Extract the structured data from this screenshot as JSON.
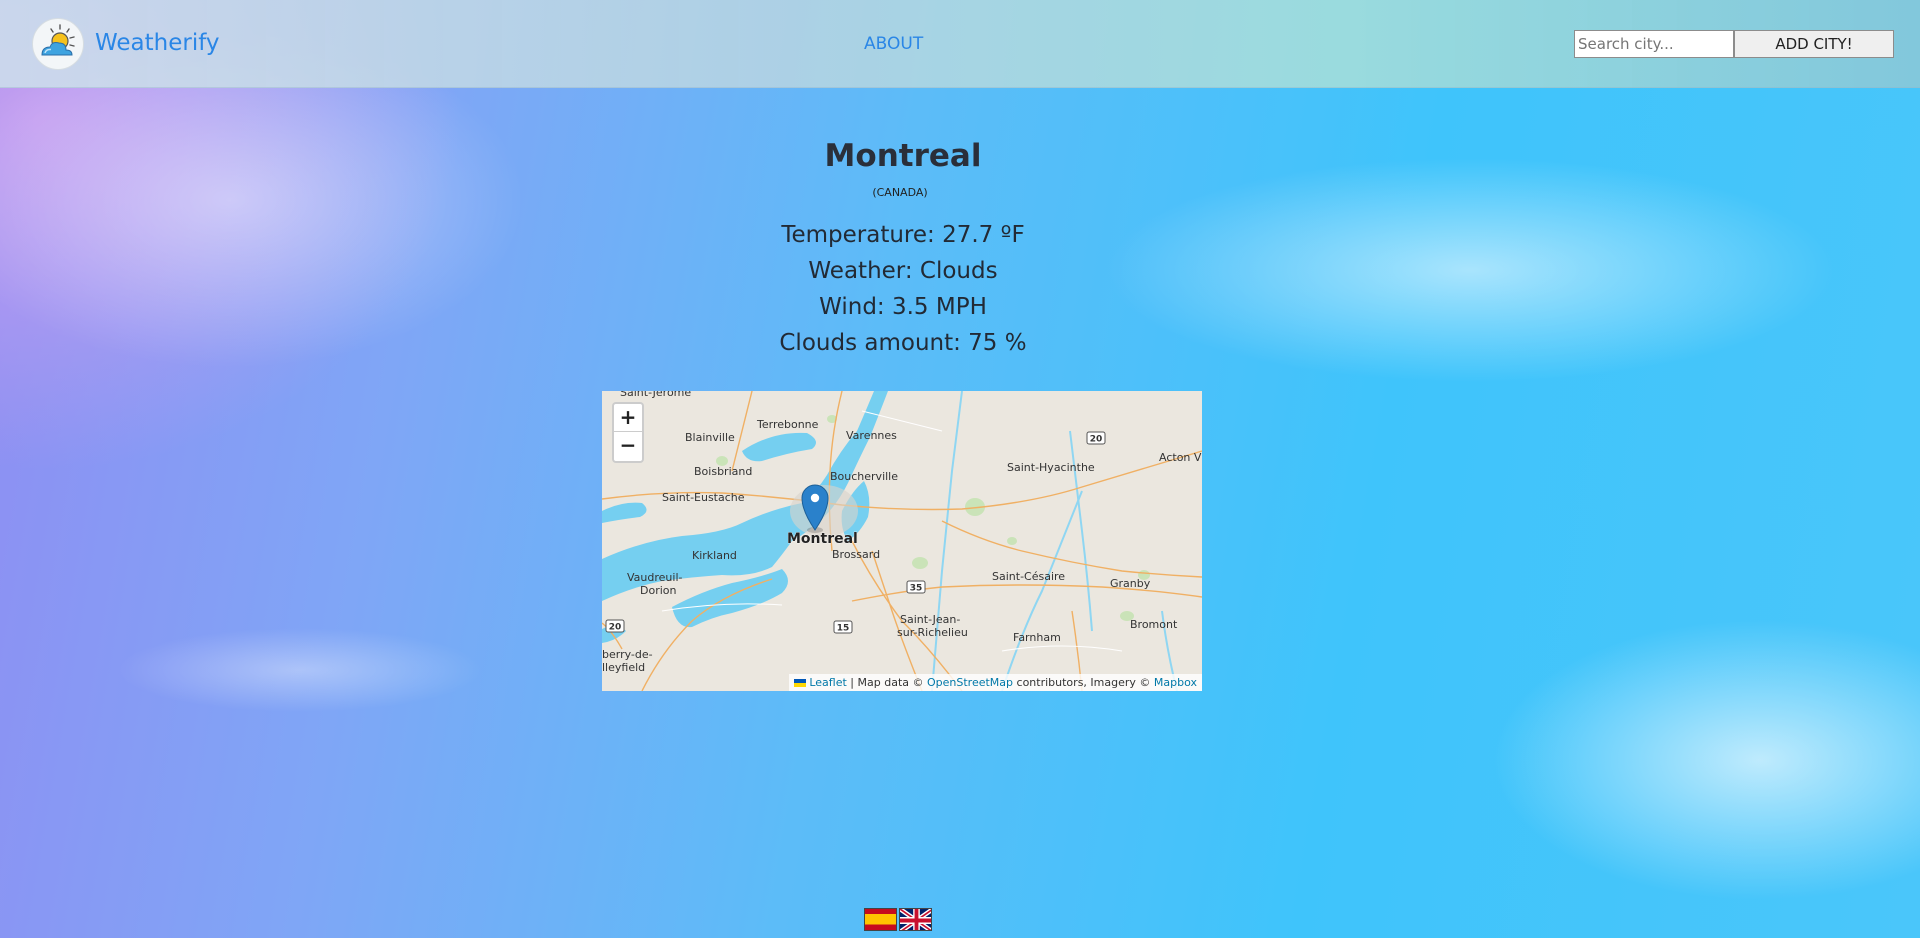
{
  "header": {
    "brand": "Weatherify",
    "about_label": "ABOUT",
    "search_placeholder": "Search city...",
    "add_city_label": "ADD CITY!"
  },
  "weather": {
    "city": "Montreal",
    "country": "(CANADA)",
    "temperature": "Temperature: 27.7 ºF",
    "conditions": "Weather: Clouds",
    "wind": "Wind: 3.5 MPH",
    "clouds": "Clouds amount: 75 %"
  },
  "map": {
    "zoom_in": "+",
    "zoom_out": "−",
    "marker_label": "Montreal",
    "attribution": {
      "leaflet": "Leaflet",
      "sep1": " | Map data © ",
      "osm": "OpenStreetMap",
      "mid": " contributors, Imagery © ",
      "mapbox": "Mapbox"
    },
    "labels": {
      "saint_jerome": "Saint-Jérôme",
      "terrebonne": "Terrebonne",
      "blainville": "Blainville",
      "varennes": "Varennes",
      "boisbriand": "Boisbriand",
      "boucherville": "Boucherville",
      "saint_eustache": "Saint-Eustache",
      "saint_hyacinthe": "Saint-Hyacinthe",
      "acton": "Acton V",
      "kirkland": "Kirkland",
      "brossard": "Brossard",
      "vaudreuil1": "Vaudreuil-",
      "vaudreuil2": "Dorion",
      "saint_cesaire": "Saint-Césaire",
      "granby": "Granby",
      "bromont": "Bromont",
      "sjr1": "Saint-Jean-",
      "sjr2": "sur-Richelieu",
      "farnham": "Farnham",
      "salaberry1": "berry-de-",
      "salaberry2": "lleyfield",
      "hwy20a": "20",
      "hwy20b": "20",
      "hwy35": "35",
      "hwy15": "15"
    }
  },
  "languages": [
    "Español",
    "English"
  ],
  "colors": {
    "brand": "#2a86e6",
    "water": "#75cff0",
    "land": "#ebe7df",
    "marker": "#2a81cb"
  }
}
